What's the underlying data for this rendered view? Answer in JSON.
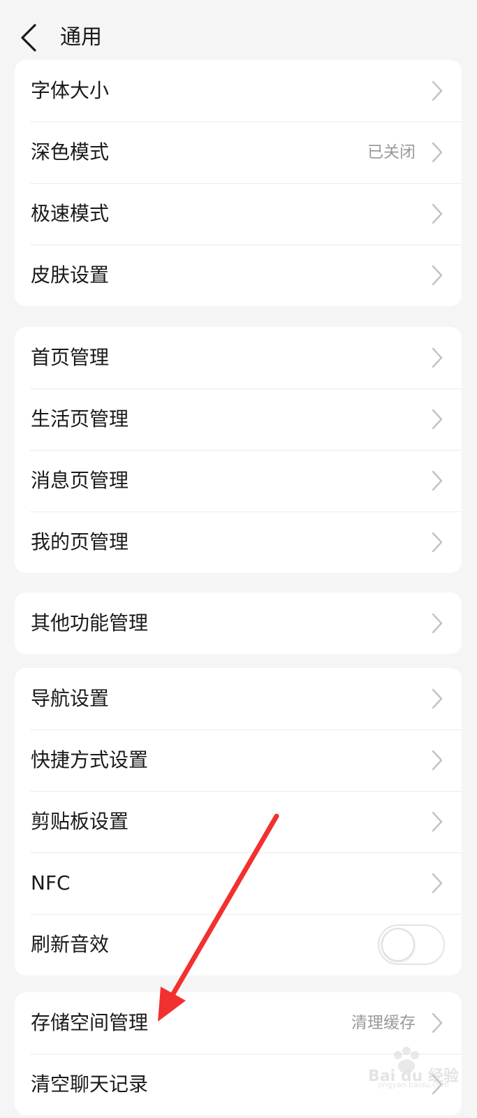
{
  "header": {
    "title": "通用"
  },
  "icons": {
    "back": "back-chevron-icon",
    "row_arrow": "chevron-right-icon"
  },
  "colors": {
    "background": "#f5f5f5",
    "card": "#ffffff",
    "text": "#1a1a1a",
    "secondary_text": "#9a9a9a",
    "chevron": "#c2c2c2",
    "annotation_arrow": "#f23030"
  },
  "groups": [
    {
      "items": [
        {
          "label": "字体大小",
          "value": ""
        },
        {
          "label": "深色模式",
          "value": "已关闭"
        },
        {
          "label": "极速模式",
          "value": ""
        },
        {
          "label": "皮肤设置",
          "value": ""
        }
      ]
    },
    {
      "items": [
        {
          "label": "首页管理",
          "value": ""
        },
        {
          "label": "生活页管理",
          "value": ""
        },
        {
          "label": "消息页管理",
          "value": ""
        },
        {
          "label": "我的页管理",
          "value": ""
        }
      ]
    },
    {
      "items": [
        {
          "label": "其他功能管理",
          "value": ""
        }
      ]
    },
    {
      "items": [
        {
          "label": "导航设置",
          "value": ""
        },
        {
          "label": "快捷方式设置",
          "value": ""
        },
        {
          "label": "剪贴板设置",
          "value": ""
        },
        {
          "label": "NFC",
          "value": ""
        },
        {
          "label": "刷新音效",
          "toggle": false
        }
      ]
    },
    {
      "items": [
        {
          "label": "存储空间管理",
          "value": "清理缓存"
        },
        {
          "label": "清空聊天记录",
          "value": ""
        }
      ]
    }
  ],
  "watermark": {
    "brand": "Bai du 经验",
    "url": "jingyan.baidu.com"
  }
}
